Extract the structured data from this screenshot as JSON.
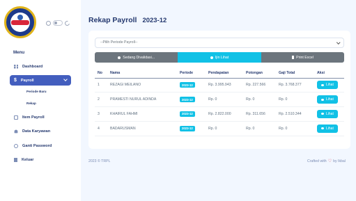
{
  "sidebar": {
    "menu_title": "Menu",
    "items": [
      {
        "label": "Dashboard",
        "icon": "grid-icon"
      },
      {
        "label": "Payroll",
        "icon": "dollar-icon",
        "active": true
      },
      {
        "label": "Item Payroll",
        "icon": "box-icon"
      },
      {
        "label": "Data Karyawan",
        "icon": "users-icon"
      },
      {
        "label": "Ganti Password",
        "icon": "lock-icon"
      },
      {
        "label": "Keluar",
        "icon": "logout-icon"
      }
    ],
    "submenu": [
      "Periode Baru",
      "Rekap"
    ]
  },
  "page": {
    "title": "Rekap Payroll",
    "period": "2023-12"
  },
  "filter": {
    "placeholder": "--Pilih Periode Payroll--"
  },
  "tabs": [
    {
      "label": "Sedang Divalidasi...",
      "icon": "dot-icon"
    },
    {
      "label": "Ijin Lihat",
      "icon": "dot-icon"
    },
    {
      "label": "Print Excel",
      "icon": "file-icon"
    }
  ],
  "table": {
    "headers": [
      "No",
      "Nama",
      "Periode",
      "Pendapatan",
      "Potongan",
      "Gaji Total",
      "Aksi"
    ],
    "rows": [
      {
        "no": "1",
        "nama": "REZAGI MEILANO",
        "periode": "2023-12",
        "pendapatan": "Rp. 3.995.943",
        "potongan": "Rp. 227.566",
        "gaji_total": "Rp. 3.768.377",
        "aksi": "Lihat"
      },
      {
        "no": "2",
        "nama": "PRAMESTI NURUL ADINDA",
        "periode": "2023-12",
        "pendapatan": "Rp. 0",
        "potongan": "Rp. 0",
        "gaji_total": "Rp. 0",
        "aksi": "Lihat"
      },
      {
        "no": "3",
        "nama": "KHAIRUL FAHMI",
        "periode": "2023-12",
        "pendapatan": "Rp. 2.822.000",
        "potongan": "Rp. 311.656",
        "gaji_total": "Rp. 2.510.344",
        "aksi": "Lihat"
      },
      {
        "no": "4",
        "nama": "BADARUSMAN",
        "periode": "2023-12",
        "pendapatan": "Rp. 0",
        "potongan": "Rp. 0",
        "gaji_total": "Rp. 0",
        "aksi": "Lihat"
      }
    ]
  },
  "footer": {
    "left": "2023 © TRPL",
    "right_prefix": "Crafted with",
    "right_suffix": "by Ikbal"
  },
  "colors": {
    "primary": "#435ebe",
    "info": "#11c1e6",
    "secondary": "#6c757d",
    "background": "#f2f7ff",
    "heart": "#dc3545"
  }
}
